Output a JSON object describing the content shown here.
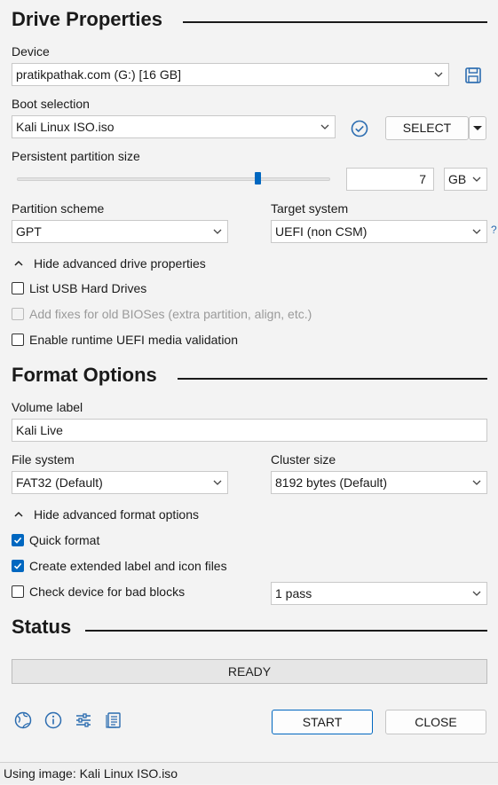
{
  "drive_properties": {
    "title": "Drive Properties",
    "device_label": "Device",
    "device_value": "pratikpathak.com (G:) [16 GB]",
    "boot_label": "Boot selection",
    "boot_value": "Kali Linux ISO.iso",
    "select_button": "SELECT",
    "persistent_label": "Persistent partition size",
    "persistent_value": "7",
    "persistent_fraction": 0.77,
    "persistent_unit": "GB",
    "partition_label": "Partition scheme",
    "partition_value": "GPT",
    "target_label": "Target system",
    "target_value": "UEFI (non CSM)",
    "target_help": "?",
    "advanced_toggle": "Hide advanced drive properties",
    "list_usb": {
      "label": "List USB Hard Drives",
      "checked": false
    },
    "add_fixes": {
      "label": "Add fixes for old BIOSes (extra partition, align, etc.)",
      "checked": false,
      "disabled": true
    },
    "runtime_uefi": {
      "label": "Enable runtime UEFI media validation",
      "checked": false
    }
  },
  "format_options": {
    "title": "Format Options",
    "volume_label": "Volume label",
    "volume_value": "Kali Live",
    "fs_label": "File system",
    "fs_value": "FAT32 (Default)",
    "cluster_label": "Cluster size",
    "cluster_value": "8192 bytes (Default)",
    "advanced_toggle": "Hide advanced format options",
    "quick_format": {
      "label": "Quick format",
      "checked": true
    },
    "extended_label": {
      "label": "Create extended label and icon files",
      "checked": true
    },
    "bad_blocks": {
      "label": "Check device for bad blocks",
      "checked": false
    },
    "passes_value": "1 pass"
  },
  "status": {
    "title": "Status",
    "progress_text": "READY"
  },
  "footer": {
    "start_button": "START",
    "close_button": "CLOSE",
    "status_bar": "Using image: Kali Linux ISO.iso"
  },
  "colors": {
    "accent": "#0067c0",
    "background": "#f3f3f3"
  }
}
